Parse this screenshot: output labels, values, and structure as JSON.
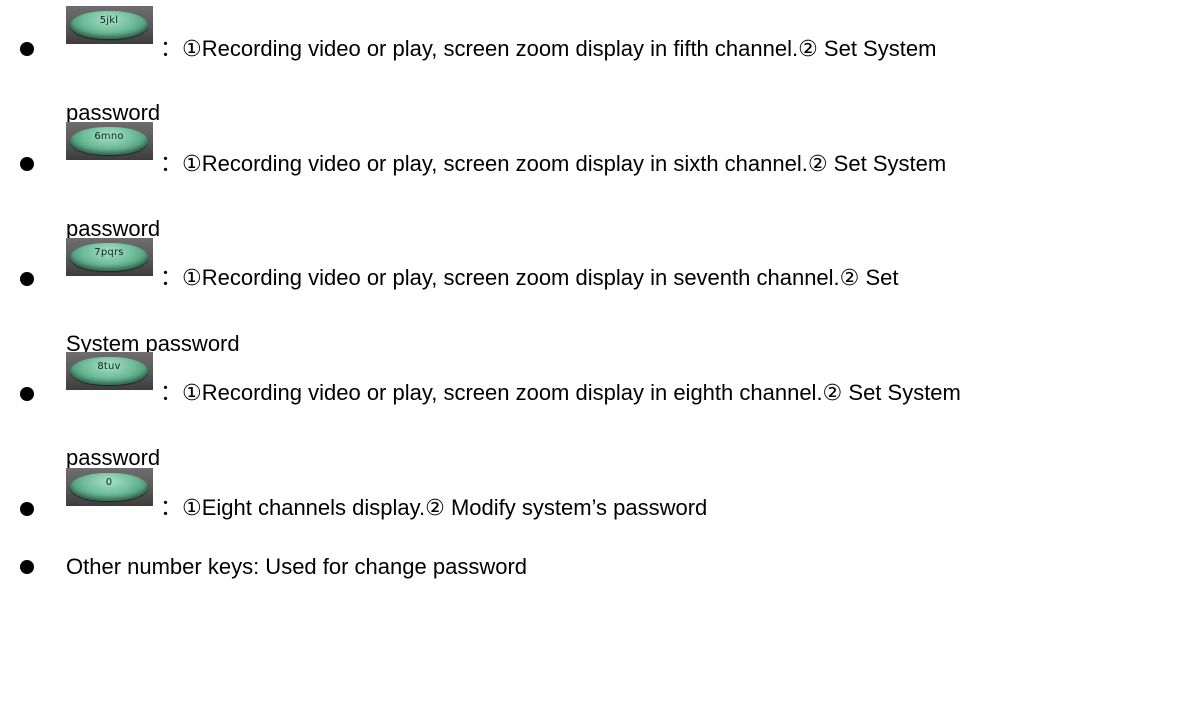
{
  "items": [
    {
      "key_label": "5jkl",
      "line1": "：①Recording video or play, screen zoom display in fifth channel.② Set System",
      "line2": "password"
    },
    {
      "key_label": "6mno",
      "line1": "：①Recording video or play, screen zoom display in sixth channel.② Set System",
      "line2": "password"
    },
    {
      "key_label": "7pqrs",
      "line1": "：①Recording video or play, screen zoom display in seventh channel.② Set",
      "line2": "System password"
    },
    {
      "key_label": "8tuv",
      "line1": "：①Recording video or play, screen zoom display in eighth channel.② Set System",
      "line2": "password"
    },
    {
      "key_label": "0",
      "line1": "：①Eight channels display.② Modify system’s password"
    },
    {
      "text": "Other number keys: Used for change password"
    }
  ]
}
